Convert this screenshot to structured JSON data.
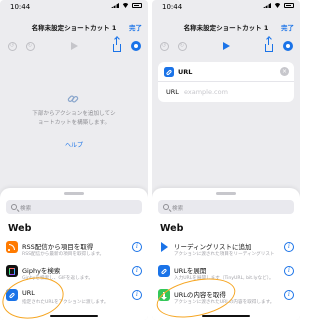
{
  "status_time": "10:44",
  "nav": {
    "title": "名称未設定ショートカット 1",
    "done_label": "完了"
  },
  "canvas": {
    "hint_line1": "下部からアクションを追加してシ",
    "hint_line2": "ョートカットを構築します。",
    "help_label": "ヘルプ"
  },
  "url_action": {
    "title": "URL",
    "param_label": "URL",
    "param_placeholder": "example.com"
  },
  "sheet": {
    "search_placeholder": "検索",
    "section_title": "Web"
  },
  "left_rows": [
    {
      "title": "RSS配信から項目を取得",
      "desc": "RSS配信から最新の項目を取得します。",
      "icon": "rss-icon"
    },
    {
      "title": "Giphyを検索",
      "desc": "Giphyを検索し、GIFを返します。",
      "icon": "giphy-icon"
    },
    {
      "title": "URL",
      "desc": "指定されたURLをアクションに渡します。",
      "icon": "link-icon"
    }
  ],
  "right_rows": [
    {
      "title": "リーディングリストに追加",
      "desc": "アクションに渡された項目をリーディングリストに追加します。",
      "icon": "arrow-icon"
    },
    {
      "title": "URLを展開",
      "desc": "入力URLを展開します（TinyURL, bit.lyなど）。",
      "icon": "link-icon"
    },
    {
      "title": "URLの内容を取得",
      "desc": "アクションに渡されたURLの内容を取得します。",
      "icon": "download-icon"
    }
  ],
  "colors": {
    "accent": "#1a73e8",
    "annotation": "#f6a623",
    "rss": "#ff7a00",
    "fetch_green": "#34c759"
  }
}
